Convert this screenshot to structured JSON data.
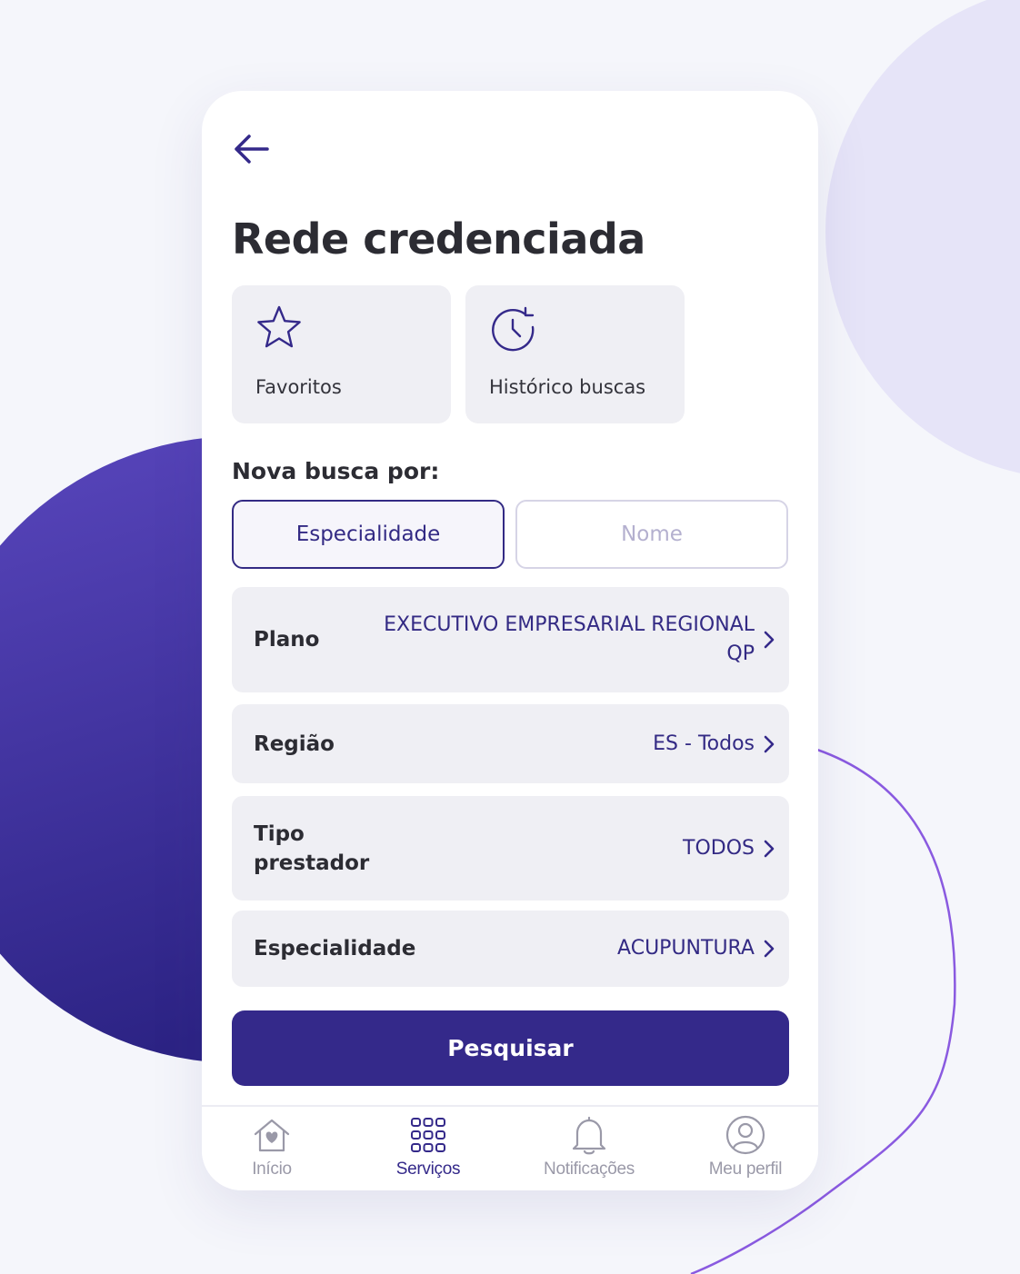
{
  "colors": {
    "primary": "#34298a",
    "surface": "#efeff4",
    "text": "#2c2c33",
    "muted": "#9a99a8",
    "accent_light": "#e6e4f8",
    "accent_line": "#8a5ae0"
  },
  "header": {
    "back_icon": "arrow-left-icon",
    "title": "Rede credenciada"
  },
  "shortcuts": [
    {
      "label": "Favoritos",
      "icon": "star-icon"
    },
    {
      "label": "Histórico buscas",
      "icon": "history-clock-icon"
    }
  ],
  "search": {
    "section_label": "Nova busca por:",
    "modes": [
      {
        "label": "Especialidade",
        "selected": true
      },
      {
        "label": "Nome",
        "selected": false
      }
    ],
    "filters": [
      {
        "label": "Plano",
        "value": "EXECUTIVO EMPRESARIAL REGIONAL QP"
      },
      {
        "label": "Região",
        "value": "ES - Todos"
      },
      {
        "label": "Tipo prestador",
        "value": "TODOS"
      },
      {
        "label": "Especialidade",
        "value": "ACUPUNTURA"
      }
    ],
    "submit_label": "Pesquisar"
  },
  "tabbar": {
    "items": [
      {
        "label": "Início",
        "icon": "home-heart-icon",
        "active": false
      },
      {
        "label": "Serviços",
        "icon": "grid-icon",
        "active": true
      },
      {
        "label": "Notificações",
        "icon": "bell-icon",
        "active": false
      },
      {
        "label": "Meu perfil",
        "icon": "user-circle-icon",
        "active": false
      }
    ]
  }
}
